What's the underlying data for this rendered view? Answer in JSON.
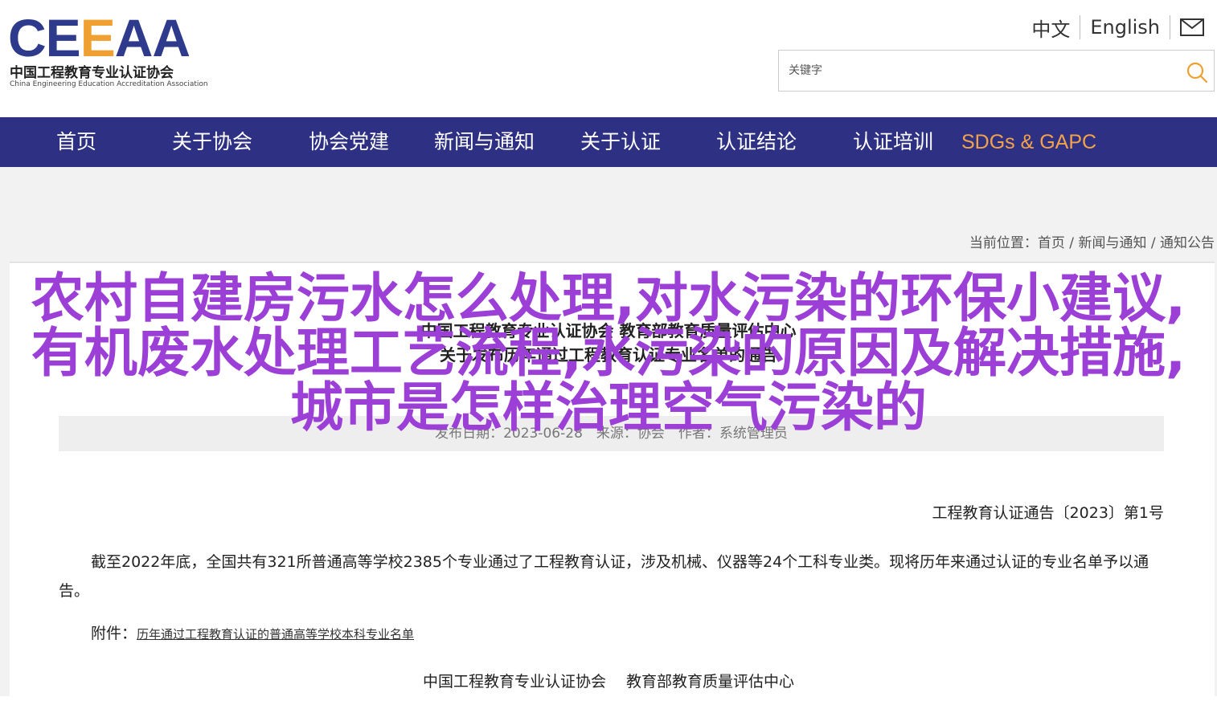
{
  "brand": {
    "logo_mark_a": "CE",
    "logo_mark_b": "E",
    "logo_mark_c": "AA",
    "name_cn": "中国工程教育专业认证协会",
    "name_en": "China Engineering Education Accreditation Association"
  },
  "lang": {
    "zh": "中文",
    "en": "English",
    "mail_icon": "mail-icon"
  },
  "search": {
    "placeholder": "关键字",
    "icon": "search-icon",
    "accent": "#f0a030"
  },
  "nav": {
    "items": [
      "首页",
      "关于协会",
      "协会党建",
      "新闻与通知",
      "关于认证",
      "认证结论",
      "认证培训",
      "SDGs & GAPC"
    ],
    "bg": "#2e3183",
    "highlight": "#f4a24a"
  },
  "breadcrumb": {
    "prefix": "当前位置：",
    "home": "首页",
    "sep": " / ",
    "section": "新闻与通知",
    "current": "通知公告"
  },
  "article": {
    "title_line1": "中国工程教育专业认证协会 教育部教育质量评估中心",
    "title_line2": "关于发布历年通过工程教育认证专业名单的通告",
    "meta": "发布日期：2023-06-28　来源：协会　作者：系统管理员",
    "notice_no": "工程教育认证通告〔2023〕第1号",
    "body": "截至2022年底，全国共有321所普通高等学校2385个专业通过了工程教育认证，涉及机械、仪器等24个工科专业类。现将历年来通过认证的专业名单予以通告。",
    "attach_label": "附件：",
    "attach_link": "历年通过工程教育认证的普通高等学校本科专业名单",
    "signers": "中国工程教育专业认证协会　 教育部教育质量评估中心"
  },
  "overlay": {
    "text": "农村自建房污水怎么处理,对水污染的环保小建议,有机废水处理工艺流程,水污染的原因及解决措施,城市是怎样治理空气污染的",
    "color": "#9b3fd6"
  }
}
